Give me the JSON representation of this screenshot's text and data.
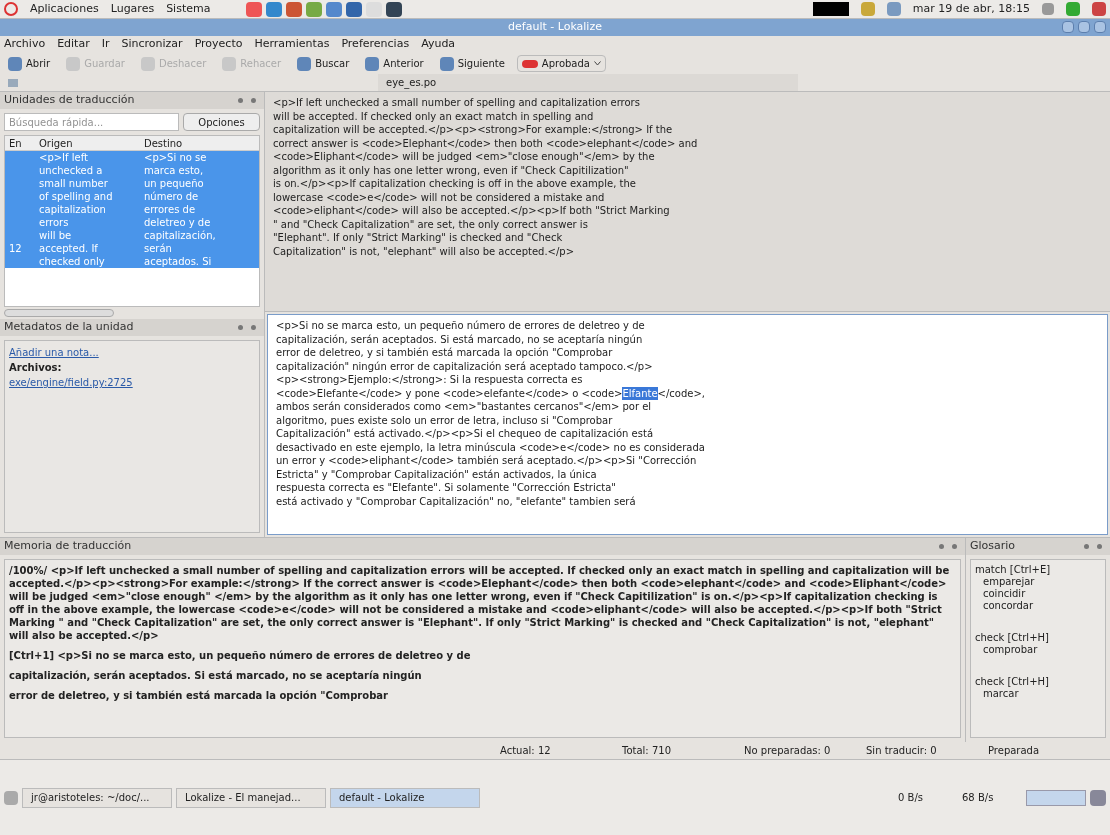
{
  "top_panel": {
    "menus": [
      "Aplicaciones",
      "Lugares",
      "Sistema"
    ],
    "clock": "mar 19 de abr, 18:15"
  },
  "window": {
    "title": "default - Lokalize"
  },
  "menu": [
    "Archivo",
    "Editar",
    "Ir",
    "Sincronizar",
    "Proyecto",
    "Herramientas",
    "Preferencias",
    "Ayuda"
  ],
  "toolbar": [
    {
      "label": "Abrir",
      "disabled": false
    },
    {
      "label": "Guardar",
      "disabled": true
    },
    {
      "label": "Deshacer",
      "disabled": true
    },
    {
      "label": "Rehacer",
      "disabled": true
    },
    {
      "label": "Buscar",
      "disabled": false
    },
    {
      "label": "Anterior",
      "disabled": false
    },
    {
      "label": "Siguiente",
      "disabled": false
    }
  ],
  "approved_button": {
    "label": "Aprobada"
  },
  "tab": {
    "label": "eye_es.po"
  },
  "units_dock": {
    "title": "Unidades de traducción",
    "search_placeholder": "Búsqueda rápida...",
    "options_button": "Opciones",
    "columns": [
      "En",
      "Origen",
      "Destino"
    ],
    "rows": [
      {
        "number": "12",
        "selected": true,
        "source_lines": [
          "<p>If left",
          "unchecked a",
          "small number",
          "of spelling and",
          "capitalization",
          "errors",
          "will be",
          "accepted. If",
          "checked only"
        ],
        "target_lines": [
          "<p>Si no se",
          "marca esto,",
          "un pequeño",
          "número de",
          "errores de",
          "deletreo y de",
          "capitalización,",
          "serán",
          "aceptados. Si"
        ]
      }
    ]
  },
  "metadata": {
    "title": "Metadatos de la unidad",
    "add_note": "Añadir una nota...",
    "files_label": "Archivos:",
    "file_link": "exe/engine/field.py:2725"
  },
  "source_lines": [
    "<p>If left unchecked a small number of spelling and capitalization errors",
    "will be accepted. If checked only an exact match in spelling and",
    "capitalization will be accepted.</p><p><strong>For example:</strong> If the",
    "correct answer is <code>Elephant</code> then both <code>elephant</code> and",
    "<code>Eliphant</code> will be judged <em>\"close enough\"</em> by the",
    "algorithm as it only has one letter wrong, even if \"Check Capitilization\"",
    "is on.</p><p>If capitalization checking is off in the above example, the",
    "lowercase <code>e</code> will not be considered a mistake and",
    "<code>eliphant</code> will also be accepted.</p><p>If both \"Strict Marking",
    "\" and \"Check Capitalization\" are set, the only correct answer is",
    "\"Elephant\". If only \"Strict Marking\" is checked and \"Check",
    "Capitalization\" is not, \"elephant\" will also be accepted.</p>"
  ],
  "target_lines": [
    "<p>Si no se marca esto, un pequeño número de errores de deletreo y de",
    "capitalización, serán aceptados. Si está marcado, no se aceptaría ningún",
    "error de deletreo, y si también está marcada la opción \"Comprobar",
    "capitalización\" ningún error de capitalización será aceptado tampoco.</p>",
    "<p><strong>Ejemplo:</strong>: Si la respuesta correcta es",
    {
      "segments": [
        {
          "text": "<code>Elefante</code> y pone <code>elefante</code> o <code>",
          "selected": false
        },
        {
          "text": "Elfante",
          "selected": true
        },
        {
          "text": "</code>,",
          "selected": false
        }
      ]
    },
    "ambos serán considerados como <em>\"bastantes cercanos\"</em> por el",
    "algoritmo, pues existe solo un error de letra, incluso si \"Comprobar",
    "Capitalización\" está activado.</p><p>Si el chequeo de capitalización está",
    "desactivado en este ejemplo, la letra minúscula <code>e</code> no es considerada",
    "un error y <code>eliphant</code> también será aceptado.</p><p>Si \"Corrección",
    "Estricta\" y \"Comprobar Capitalización\" están activados, la única",
    "respuesta correcta es \"Elefante\". Si solamente \"Corrección Estricta\"",
    "está activado y \"Comprobar Capitalización\" no, \"elefante\" tambien será"
  ],
  "memory": {
    "title": "Memoria de traducción",
    "entries": [
      "/100%/ <p>If left unchecked a small number of spelling and capitalization errors will be accepted. If checked only an exact match in spelling and capitalization will be accepted.</p><p><strong>For example:</strong> If the correct answer is <code>Elephant</code> then both <code>elephant</code> and <code>Eliphant</code> will be judged <em>\"close enough\" </em> by the algorithm as it only has one letter wrong, even if \"Check Capitilization\" is on.</p><p>If capitalization checking is off in the above example, the lowercase <code>e</code> will not be considered a mistake and <code>eliphant</code> will also be accepted.</p><p>If both \"Strict Marking \" and \"Check Capitalization\" are set, the only correct answer is \"Elephant\". If only \"Strict Marking\" is checked and \"Check Capitalization\" is not, \"elephant\" will also be accepted.</p>",
      "[Ctrl+1] <p>Si no se marca esto, un pequeño número de errores de deletreo y de",
      "capitalización, serán aceptados. Si está marcado, no se aceptaría ningún",
      "error de deletreo, y si también está marcada la opción \"Comprobar"
    ]
  },
  "glossary": {
    "title": "Glosario",
    "entries": [
      {
        "term": "match [Ctrl+E]",
        "translations": [
          "emparejar",
          "coincidir",
          "concordar"
        ]
      },
      {
        "term": "check [Ctrl+H]",
        "translations": [
          "comprobar"
        ]
      },
      {
        "term": "check [Ctrl+H]",
        "translations": [
          "marcar"
        ]
      }
    ]
  },
  "status_bar": [
    "Actual: 12",
    "Total: 710",
    "No preparadas: 0",
    "Sin traducir: 0",
    "Preparada"
  ],
  "taskbar": {
    "items": [
      {
        "label": "jr@aristoteles: ~/doc/...",
        "selected": false
      },
      {
        "label": "Lokalize - El manejad...",
        "selected": false
      },
      {
        "label": "default - Lokalize",
        "selected": true
      }
    ],
    "net_down": "0 B/s",
    "net_up": "68 B/s"
  }
}
